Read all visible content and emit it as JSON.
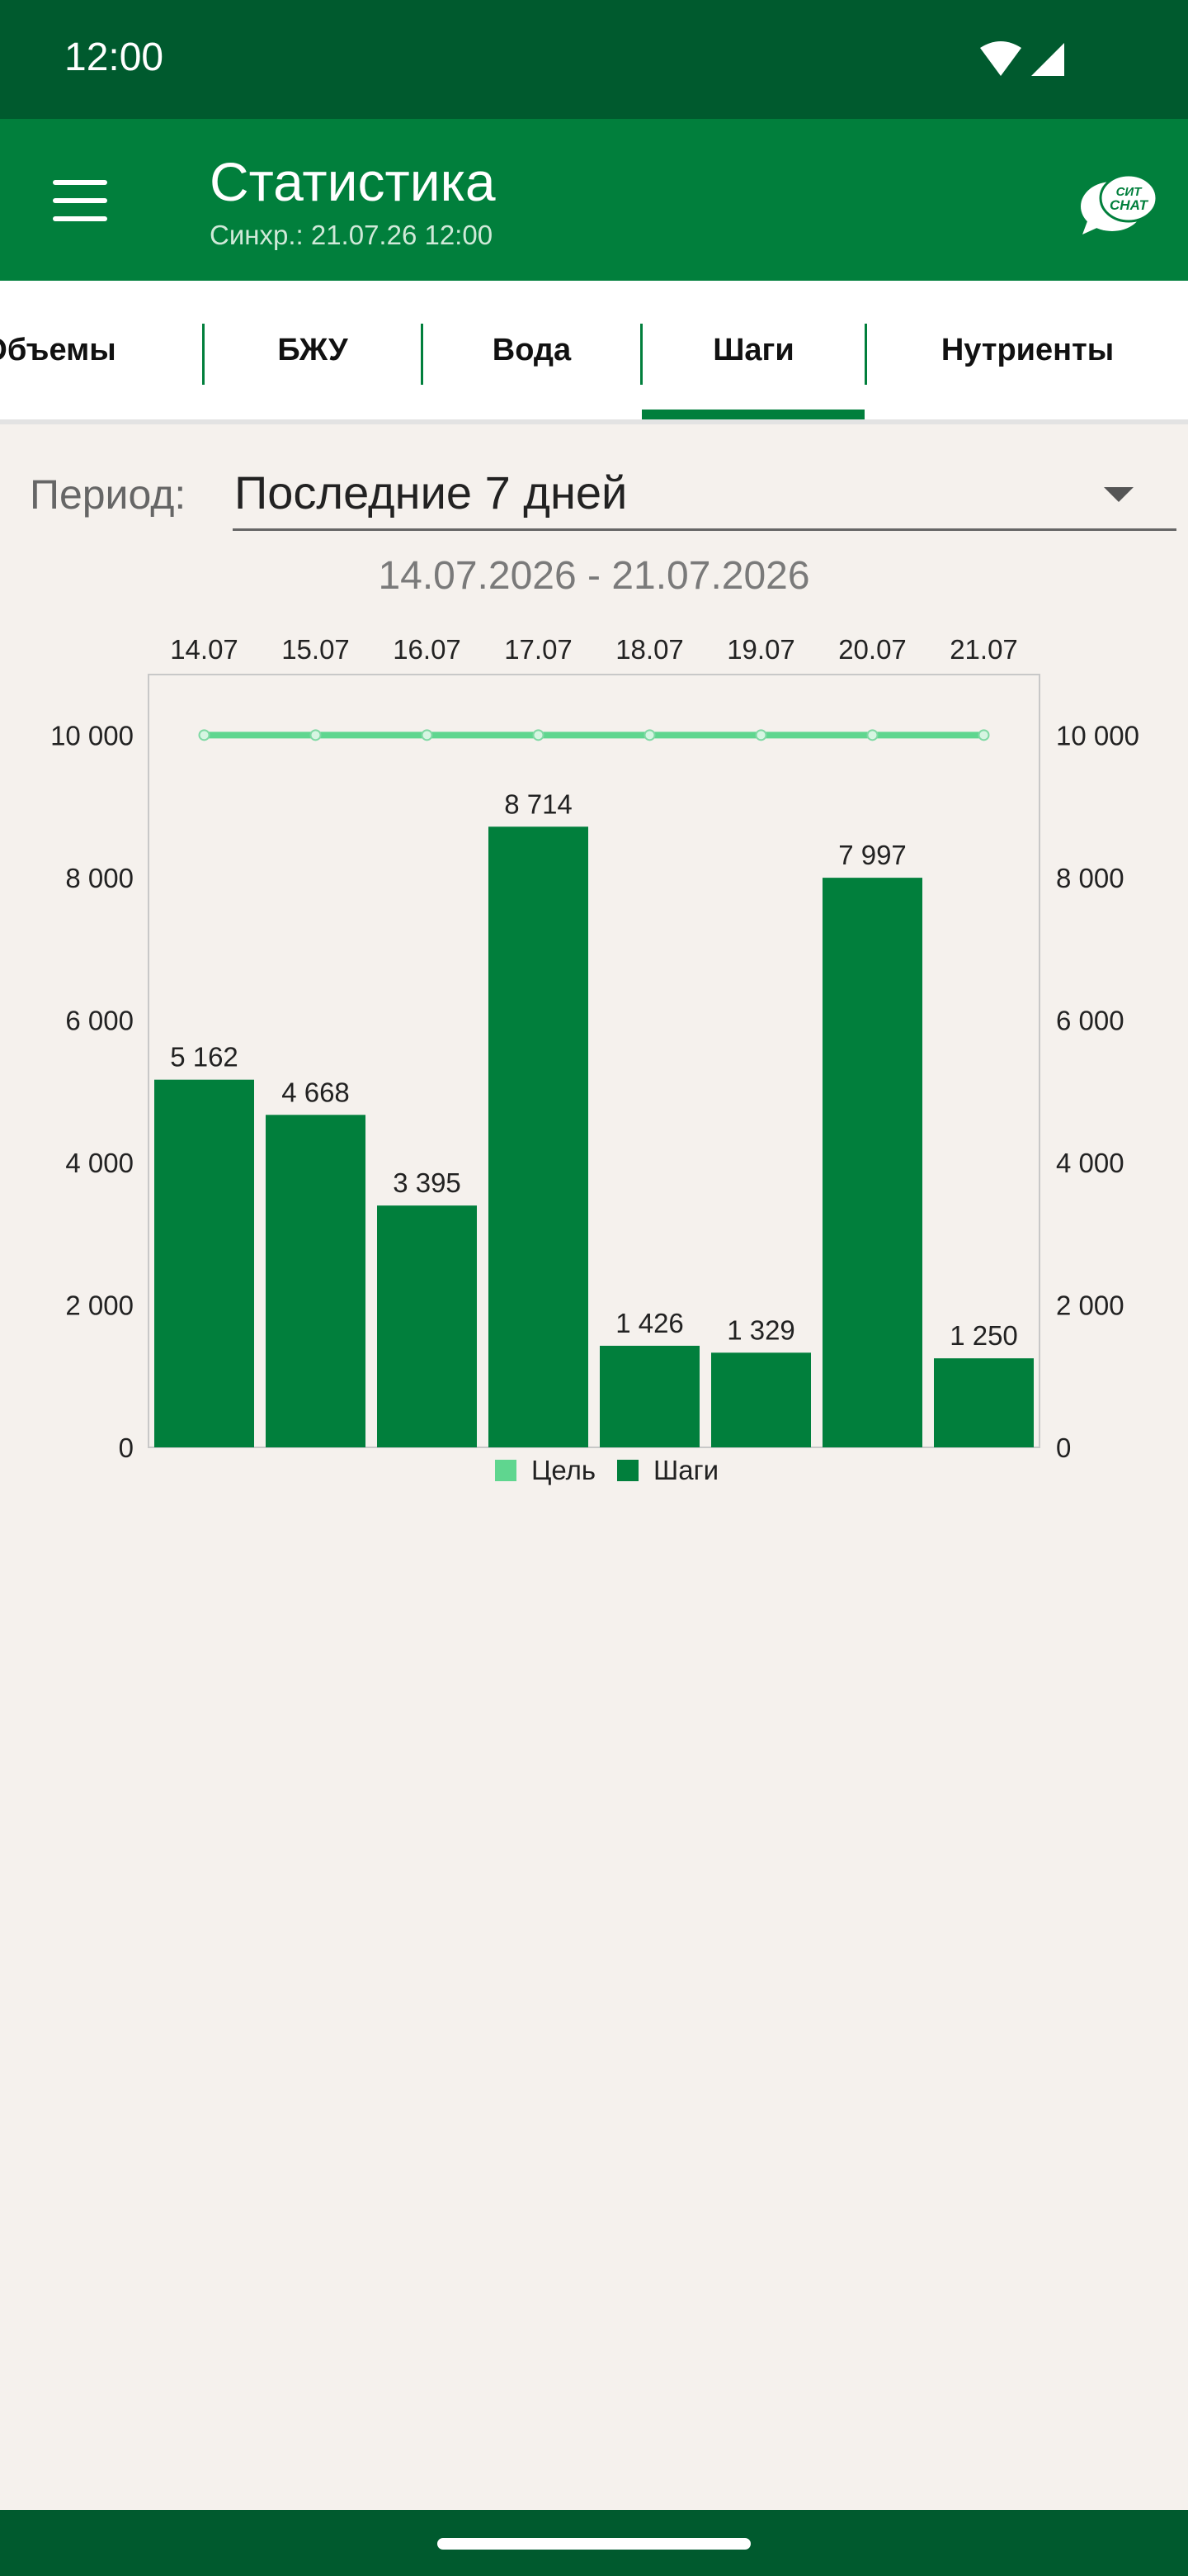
{
  "status": {
    "time": "12:00"
  },
  "header": {
    "title": "Статистика",
    "subtitle": "Синхр.: 21.07.26 12:00",
    "chat_logo_line1": "СИТ",
    "chat_logo_line2": "CHAT"
  },
  "tabs": [
    {
      "label": "Объемы",
      "active": false
    },
    {
      "label": "БЖУ",
      "active": false
    },
    {
      "label": "Вода",
      "active": false
    },
    {
      "label": "Шаги",
      "active": true
    },
    {
      "label": "Нутриенты",
      "active": false
    }
  ],
  "period": {
    "label": "Период:",
    "value": "Последние 7 дней"
  },
  "date_range": "14.07.2026 - 21.07.2026",
  "colors": {
    "brand": "#017f3c",
    "brand_dark": "#005a2e",
    "goal": "#5fd68f",
    "background": "#f5f1ed"
  },
  "chart_data": {
    "type": "bar",
    "categories": [
      "14.07",
      "15.07",
      "16.07",
      "17.07",
      "18.07",
      "19.07",
      "20.07",
      "21.07"
    ],
    "series": [
      {
        "name": "Шаги",
        "type": "bar",
        "color": "#017f3c",
        "values": [
          5162,
          4668,
          3395,
          8714,
          1426,
          1329,
          7997,
          1250
        ],
        "labels": [
          "5 162",
          "4 668",
          "3 395",
          "8 714",
          "1 426",
          "1 329",
          "7 997",
          "1 250"
        ]
      },
      {
        "name": "Цель",
        "type": "line",
        "color": "#5fd68f",
        "values": [
          10000,
          10000,
          10000,
          10000,
          10000,
          10000,
          10000,
          10000
        ]
      }
    ],
    "ylim": [
      0,
      10850
    ],
    "yticks": [
      0,
      2000,
      4000,
      6000,
      8000,
      10000
    ],
    "ytick_labels": [
      "0",
      "2 000",
      "4 000",
      "6 000",
      "8 000",
      "10 000"
    ],
    "legend": {
      "position": "bottom",
      "items": [
        "Цель",
        "Шаги"
      ]
    },
    "grid": false
  }
}
